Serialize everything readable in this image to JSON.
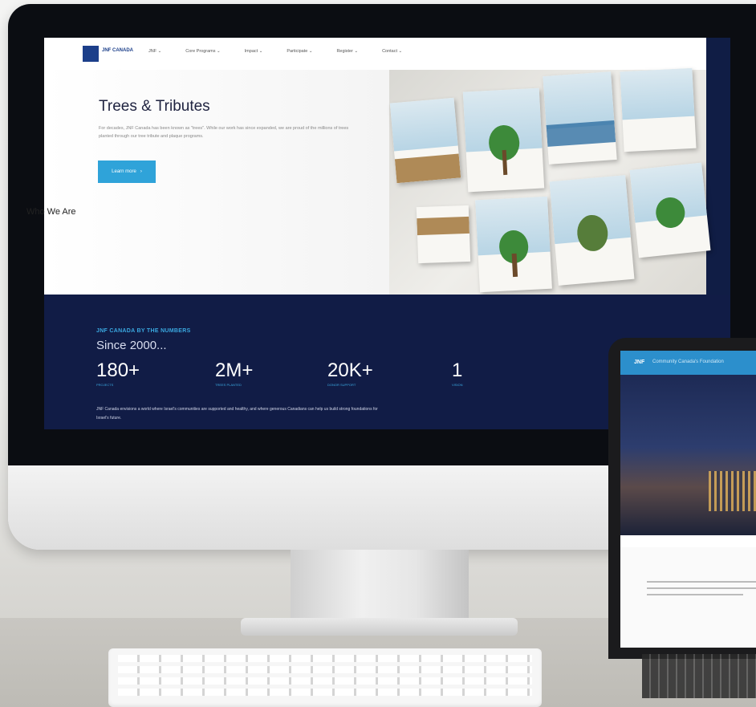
{
  "site": {
    "logo_text": "JNF CANADA",
    "nav": [
      "JNF ⌄",
      "Core Programs ⌄",
      "Impact ⌄",
      "Participate ⌄",
      "Register ⌄",
      "Contact ⌄"
    ],
    "hero": {
      "title": "Trees & Tributes",
      "body": "For decades, JNF Canada has been known as \"trees\". While our work has since expanded, we are proud of the millions of trees planted through our tree tribute and plaque programs.",
      "button_label": "Learn more",
      "button_icon": "arrow-right-icon"
    },
    "numbers": {
      "heading": "JNF CANADA BY THE NUMBERS",
      "since": "Since 2000...",
      "stats": [
        {
          "value": "180+",
          "label": "PROJECTS"
        },
        {
          "value": "2M+",
          "label": "TREES PLANTED"
        },
        {
          "value": "20K+",
          "label": "DONOR SUPPORT"
        },
        {
          "value": "1",
          "label": "VISION"
        }
      ],
      "body": "JNF Canada envisions a world where Israel's communities are supported and healthy, and where generous Canadians can help us build strong foundations for Israel's future."
    }
  },
  "laptop": {
    "logo": "JNF",
    "tagline": "Community Canada's Foundation",
    "section_title": "Who We Are"
  },
  "colors": {
    "accent": "#2fa3d9",
    "navy": "#111c46",
    "bezel": "#0b0d12"
  }
}
